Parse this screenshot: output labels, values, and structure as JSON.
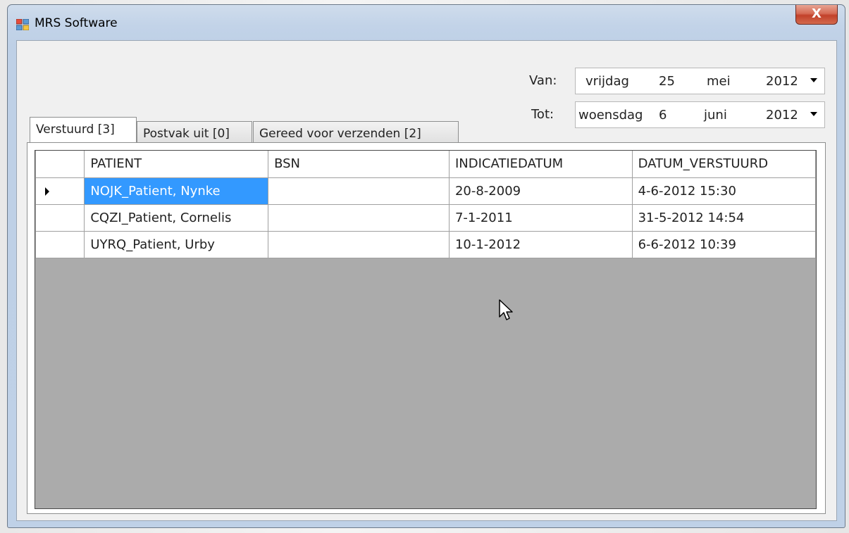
{
  "window": {
    "title": "MRS Software",
    "close_label": "X"
  },
  "filters": {
    "van_label": "Van:",
    "van_date": {
      "weekday": "vrijdag",
      "day": "25",
      "month": "mei",
      "year": "2012"
    },
    "tot_label": "Tot:",
    "tot_date": {
      "weekday": "woensdag",
      "day": "6",
      "month": "juni",
      "year": "2012"
    }
  },
  "tabs": [
    {
      "label": "Verstuurd [3]",
      "active": true
    },
    {
      "label": "Postvak uit [0]",
      "active": false
    },
    {
      "label": "Gereed voor verzenden [2]",
      "active": false
    }
  ],
  "grid": {
    "columns": [
      "PATIENT",
      "BSN",
      "INDICATIEDATUM",
      "DATUM_VERSTUURD"
    ],
    "rows": [
      {
        "patient": "NOJK_Patient, Nynke",
        "bsn": "",
        "indicatiedatum": "20-8-2009",
        "datum_verstuurd": "4-6-2012 15:30",
        "current": true
      },
      {
        "patient": "CQZI_Patient, Cornelis",
        "bsn": "",
        "indicatiedatum": "7-1-2011",
        "datum_verstuurd": "31-5-2012 14:54",
        "current": false
      },
      {
        "patient": "UYRQ_Patient, Urby",
        "bsn": "",
        "indicatiedatum": "10-1-2012",
        "datum_verstuurd": "6-6-2012 10:39",
        "current": false
      }
    ]
  },
  "colors": {
    "selection": "#3399ff",
    "grid_background": "#ababab",
    "close_button": "#c2412a"
  }
}
